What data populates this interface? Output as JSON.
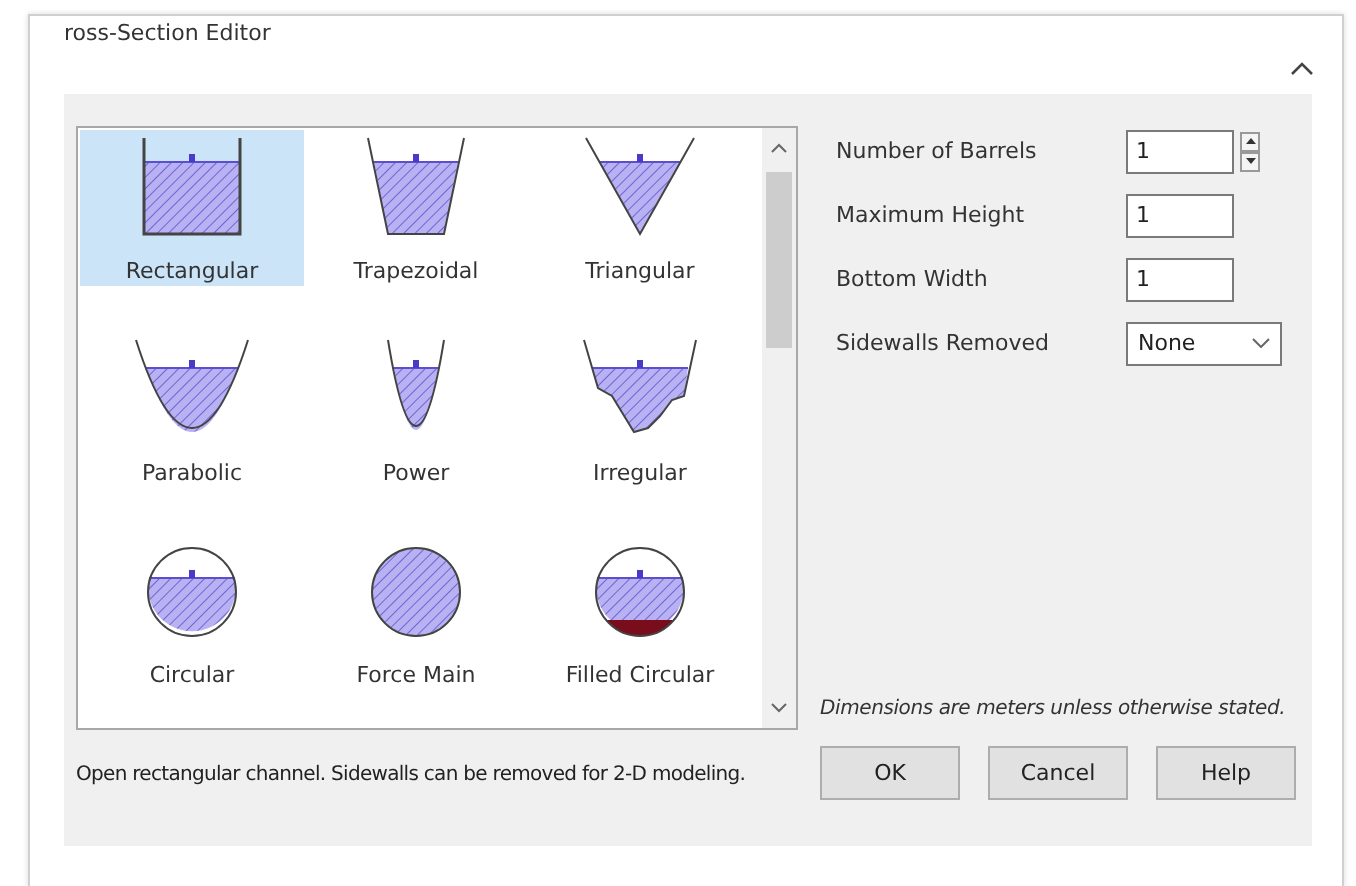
{
  "window": {
    "title": "ross-Section Editor"
  },
  "shapes": [
    {
      "label": "Rectangular",
      "kind": "rectangular",
      "selected": true
    },
    {
      "label": "Trapezoidal",
      "kind": "trapezoidal",
      "selected": false
    },
    {
      "label": "Triangular",
      "kind": "triangular",
      "selected": false
    },
    {
      "label": "Parabolic",
      "kind": "parabolic",
      "selected": false
    },
    {
      "label": "Power",
      "kind": "power",
      "selected": false
    },
    {
      "label": "Irregular",
      "kind": "irregular",
      "selected": false
    },
    {
      "label": "Circular",
      "kind": "circular",
      "selected": false
    },
    {
      "label": "Force Main",
      "kind": "force_main",
      "selected": false
    },
    {
      "label": "Filled Circular",
      "kind": "filled_circular",
      "selected": false
    }
  ],
  "fields": [
    {
      "label": "Number of Barrels",
      "kind": "spinner",
      "value": "1"
    },
    {
      "label": "Maximum Height",
      "kind": "text",
      "value": "1"
    },
    {
      "label": "Bottom Width",
      "kind": "text",
      "value": "1"
    },
    {
      "label": "Sidewalls Removed",
      "kind": "select",
      "value": "None"
    }
  ],
  "note": "Dimensions are meters unless otherwise stated.",
  "description": "Open rectangular channel. Sidewalls can be removed for 2-D modeling.",
  "buttons": [
    "OK",
    "Cancel",
    "Help"
  ]
}
